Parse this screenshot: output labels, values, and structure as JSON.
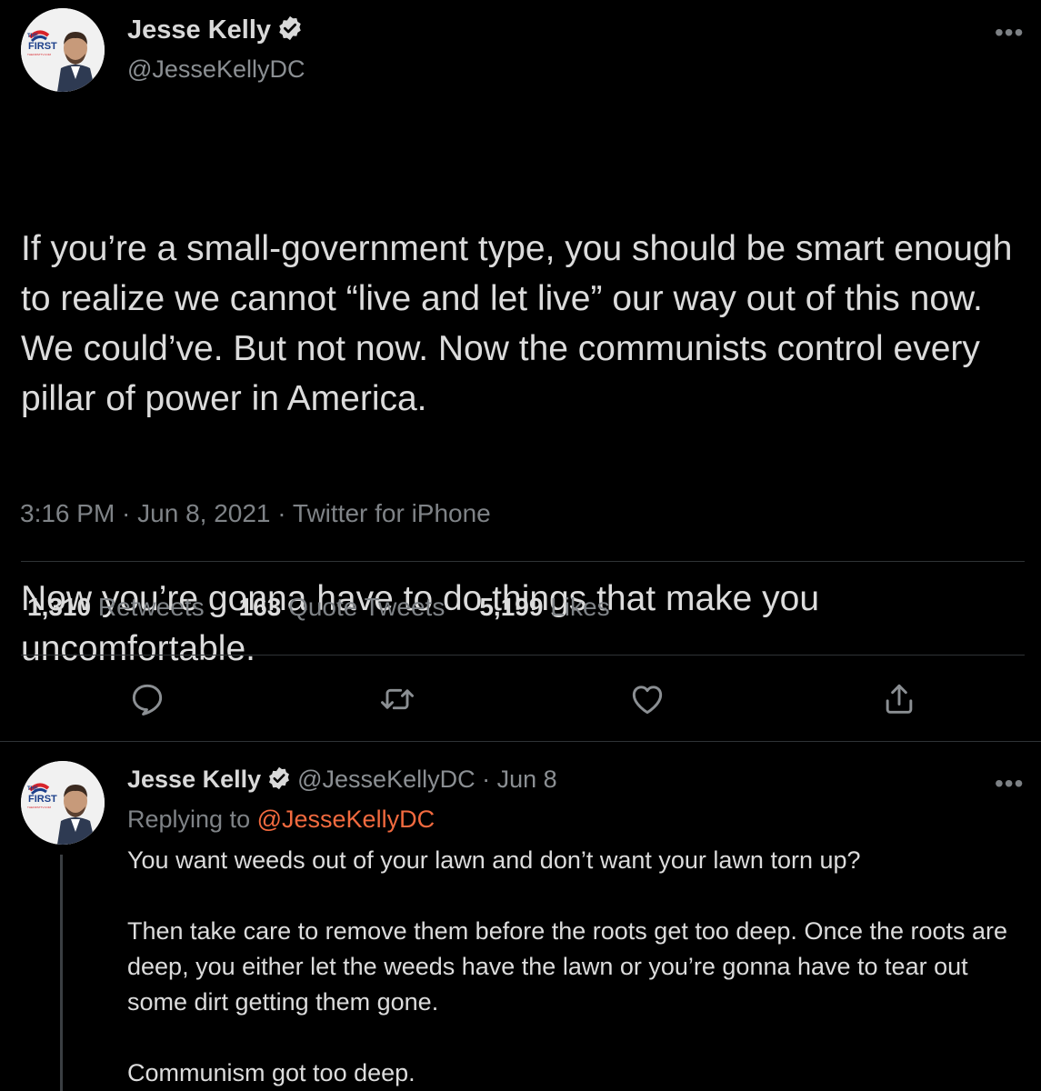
{
  "main_tweet": {
    "author_name": "Jesse Kelly",
    "handle": "@JesseKellyDC",
    "avatar_logo": {
      "line1": "THE",
      "line2": "FIRST",
      "line3": "THEFIRSTTV.COM"
    },
    "text_paragraphs": [
      "If you’re a small-government type, you should be smart enough to realize we cannot “live and let live” our way out of this now. We could’ve. But not now. Now the communists control every pillar of power in America.",
      "Now you’re gonna have to do things that make you uncomfortable."
    ],
    "timestamp": "3:16 PM · Jun 8, 2021 · Twitter for iPhone",
    "stats": {
      "retweets_count": "1,310",
      "retweets_label": "Retweets",
      "quotes_count": "163",
      "quotes_label": "Quote Tweets",
      "likes_count": "5,199",
      "likes_label": "Likes"
    },
    "actions": [
      "reply-icon",
      "retweet-icon",
      "like-icon",
      "share-icon"
    ],
    "more_icon": "more-options-icon"
  },
  "reply_tweet": {
    "author_name": "Jesse Kelly",
    "handle_and_date": "@JesseKellyDC · Jun 8",
    "replying_prefix": "Replying to",
    "replying_to": "@JesseKellyDC",
    "text_paragraphs": [
      "You want weeds out of your lawn and don’t want your lawn torn up?",
      "Then take care to remove them before the roots get too deep. Once the roots are deep, you either let the weeds have the lawn or you’re gonna have to tear out some dirt getting them gone.",
      "Communism got too deep."
    ]
  },
  "colors": {
    "background": "#000000",
    "text": "#d9d9d9",
    "muted": "#7f8387",
    "mention": "#f26a3f",
    "divider": "#2f3336",
    "verified": "#d9d9d9"
  }
}
